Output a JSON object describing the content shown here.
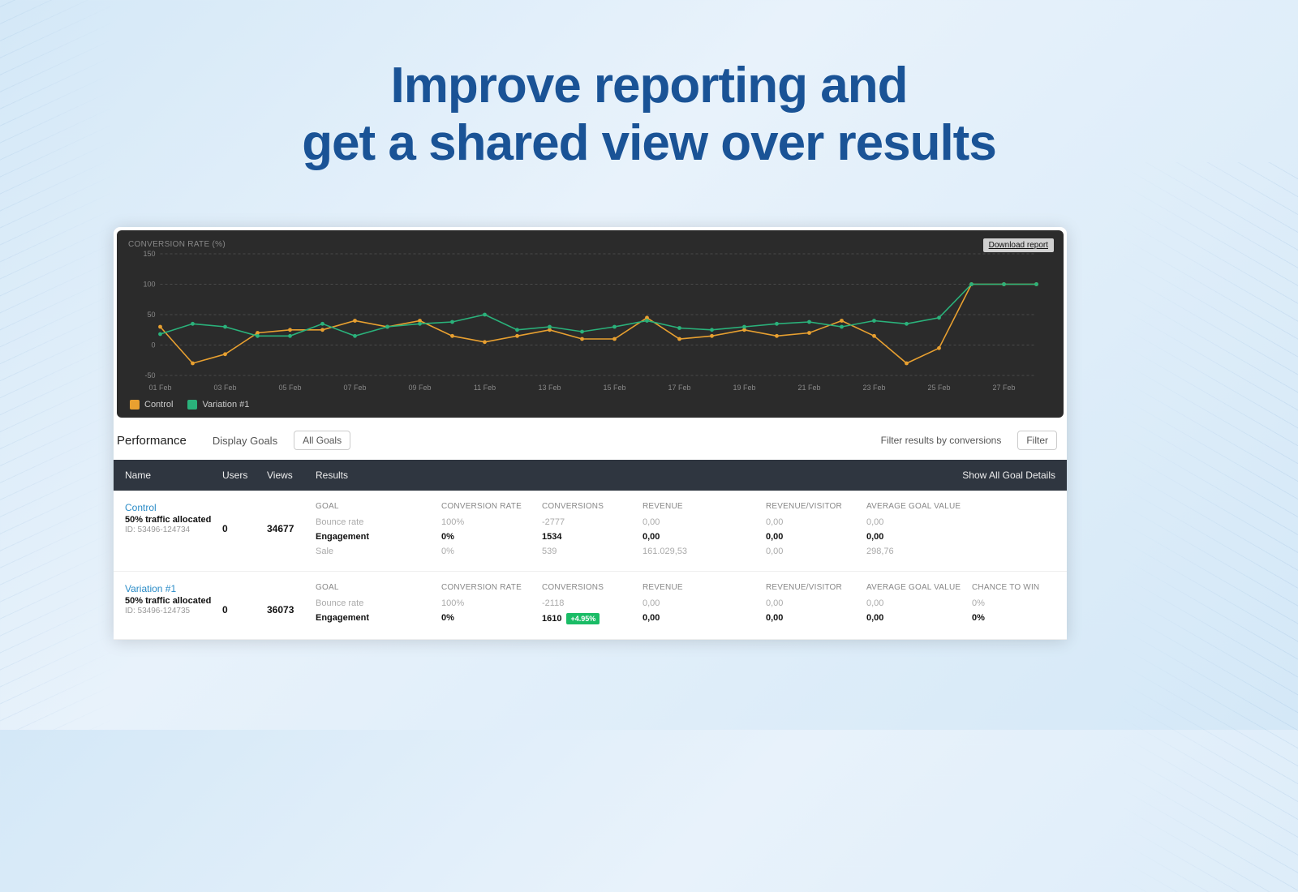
{
  "hero": {
    "line1": "Improve reporting and",
    "line2": "get a shared view over results"
  },
  "chart": {
    "title": "CONVERSION RATE (%)",
    "download_label": "Download report",
    "y_ticks": [
      "150",
      "100",
      "50",
      "0",
      "-50"
    ],
    "x_ticks": [
      "01 Feb",
      "03 Feb",
      "05 Feb",
      "07 Feb",
      "09 Feb",
      "11 Feb",
      "13 Feb",
      "15 Feb",
      "17 Feb",
      "19 Feb",
      "21 Feb",
      "23 Feb",
      "25 Feb",
      "27 Feb"
    ],
    "legend": [
      {
        "name": "Control",
        "color": "#e8a030"
      },
      {
        "name": "Variation #1",
        "color": "#2ab27b"
      }
    ]
  },
  "chart_data": {
    "type": "line",
    "title": "CONVERSION RATE (%)",
    "xlabel": "",
    "ylabel": "",
    "ylim": [
      -50,
      150
    ],
    "x": [
      "01 Feb",
      "02 Feb",
      "03 Feb",
      "04 Feb",
      "05 Feb",
      "06 Feb",
      "07 Feb",
      "08 Feb",
      "09 Feb",
      "10 Feb",
      "11 Feb",
      "12 Feb",
      "13 Feb",
      "14 Feb",
      "15 Feb",
      "16 Feb",
      "17 Feb",
      "18 Feb",
      "19 Feb",
      "20 Feb",
      "21 Feb",
      "22 Feb",
      "23 Feb",
      "24 Feb",
      "25 Feb",
      "26 Feb",
      "27 Feb",
      "28 Feb"
    ],
    "series": [
      {
        "name": "Control",
        "color": "#e8a030",
        "values": [
          30,
          -30,
          -15,
          20,
          25,
          25,
          40,
          30,
          40,
          15,
          5,
          15,
          25,
          10,
          10,
          45,
          10,
          15,
          25,
          15,
          20,
          40,
          15,
          -30,
          -5,
          100,
          100,
          100
        ]
      },
      {
        "name": "Variation #1",
        "color": "#2ab27b",
        "values": [
          18,
          35,
          30,
          15,
          15,
          35,
          15,
          30,
          35,
          38,
          50,
          25,
          30,
          22,
          30,
          40,
          28,
          25,
          30,
          35,
          38,
          30,
          40,
          35,
          45,
          100,
          100,
          100
        ]
      }
    ]
  },
  "performance": {
    "title": "Performance",
    "display_goals_label": "Display Goals",
    "all_goals_btn": "All Goals",
    "filter_label": "Filter results by conversions",
    "filter_btn": "Filter"
  },
  "table": {
    "headers": {
      "name": "Name",
      "users": "Users",
      "views": "Views",
      "results": "Results",
      "show_all": "Show All Goal Details"
    },
    "result_headers": {
      "goal": "GOAL",
      "cr": "CONVERSION RATE",
      "conv": "CONVERSIONS",
      "rev": "REVENUE",
      "rpv": "REVENUE/VISITOR",
      "agv": "AVERAGE GOAL VALUE",
      "ctw": "CHANCE TO WIN"
    },
    "rows": [
      {
        "name": "Control",
        "name_class": "control",
        "alloc": "50% traffic allocated",
        "id": "ID: 53496-124734",
        "users": "0",
        "views": "34677",
        "goals": [
          {
            "label": "Bounce rate",
            "cr": "100%",
            "conv": "-2777",
            "rev": "0,00",
            "rpv": "0,00",
            "agv": "0,00",
            "ctw": "",
            "active": false
          },
          {
            "label": "Engagement",
            "cr": "0%",
            "conv": "1534",
            "rev": "0,00",
            "rpv": "0,00",
            "agv": "0,00",
            "ctw": "",
            "active": true
          },
          {
            "label": "Sale",
            "cr": "0%",
            "conv": "539",
            "rev": "161.029,53",
            "rpv": "0,00",
            "agv": "298,76",
            "ctw": "",
            "active": false
          }
        ]
      },
      {
        "name": "Variation #1",
        "name_class": "variation",
        "alloc": "50% traffic allocated",
        "id": "ID: 53496-124735",
        "users": "0",
        "views": "36073",
        "goals": [
          {
            "label": "Bounce rate",
            "cr": "100%",
            "conv": "-2118",
            "rev": "0,00",
            "rpv": "0,00",
            "agv": "0,00",
            "ctw": "0%",
            "active": false
          },
          {
            "label": "Engagement",
            "cr": "0%",
            "conv": "1610",
            "conv_badge": "+4.95%",
            "rev": "0,00",
            "rpv": "0,00",
            "agv": "0,00",
            "ctw": "0%",
            "active": true
          }
        ]
      }
    ]
  }
}
